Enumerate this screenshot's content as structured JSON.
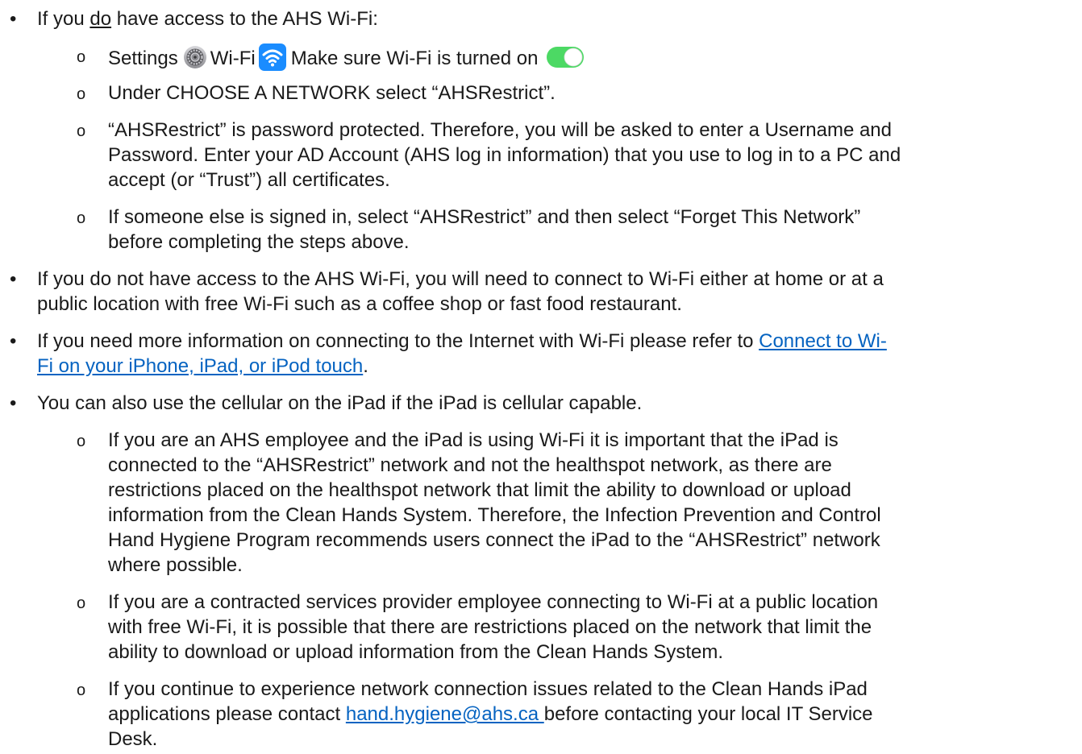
{
  "bullets": {
    "b1": {
      "prefix": "If you ",
      "emph": "do",
      "suffix": " have access to the AHS Wi-Fi:"
    },
    "b1_1": {
      "settings": "Settings",
      "wifi": "Wi-Fi",
      "make_sure": "Make sure Wi-Fi is turned on"
    },
    "b1_2": "Under CHOOSE A NETWORK select “AHSRestrict”.",
    "b1_3": {
      "line1": "“AHSRestrict” is password protected. Therefore, you will be asked to enter a Username and",
      "line2": "Password. Enter your AD Account (AHS log in information) that you use to log in to a PC and",
      "line3": "accept (or “Trust”) all certificates."
    },
    "b1_4": {
      "line1": "If someone else is signed in, select “AHSRestrict” and then select “Forget This Network”",
      "line2": "before completing the steps above."
    },
    "b2": {
      "line1": "If you do not have access to the AHS Wi-Fi, you will need to connect to Wi-Fi either at home or at a",
      "line2": "public location with free Wi-Fi such as a coffee shop or fast food restaurant."
    },
    "b3": {
      "line1_text": "If you need more information on connecting to the Internet with Wi-Fi please refer to ",
      "line1_link": "Connect to Wi-",
      "line2_link": "Fi on your iPhone, iPad, or iPod touch",
      "line2_suffix": "."
    },
    "b4": "You can also use the cellular on the iPad if the iPad is cellular capable.",
    "b4_1": {
      "line1": "If you are an AHS employee and the iPad is using Wi-Fi it is important that the iPad is",
      "line2": "connected to the “AHSRestrict” network and not the healthspot network, as there are",
      "line3": "restrictions placed on the healthspot network that limit the ability to download or upload",
      "line4": "information from the Clean Hands System. Therefore, the Infection Prevention and Control",
      "line5": "Hand Hygiene Program recommends users connect the iPad to the “AHSRestrict” network",
      "line6": "where possible."
    },
    "b4_2": {
      "line1": "If you are a contracted services provider employee connecting to Wi-Fi at a public location",
      "line2": "with free Wi-Fi, it is possible that there are restrictions placed on the network that limit the",
      "line3": "ability to download or upload information from the Clean Hands System."
    },
    "b4_3": {
      "line1": "If you continue to experience network connection issues related to the Clean Hands iPad",
      "line2_prefix": "applications please contact ",
      "line2_link": "hand.hygiene@ahs.ca ",
      "line2_suffix": "before contacting your local IT Service",
      "line3": "Desk."
    }
  },
  "markers": {
    "level1": "•",
    "level2": "o"
  },
  "icons": {
    "settings": "settings-gear-icon",
    "wifi": "wifi-icon",
    "toggle": "toggle-on-icon"
  },
  "colors": {
    "link": "#0563c1",
    "wifi_blue": "#1a8cff",
    "toggle_green": "#4cd964"
  }
}
